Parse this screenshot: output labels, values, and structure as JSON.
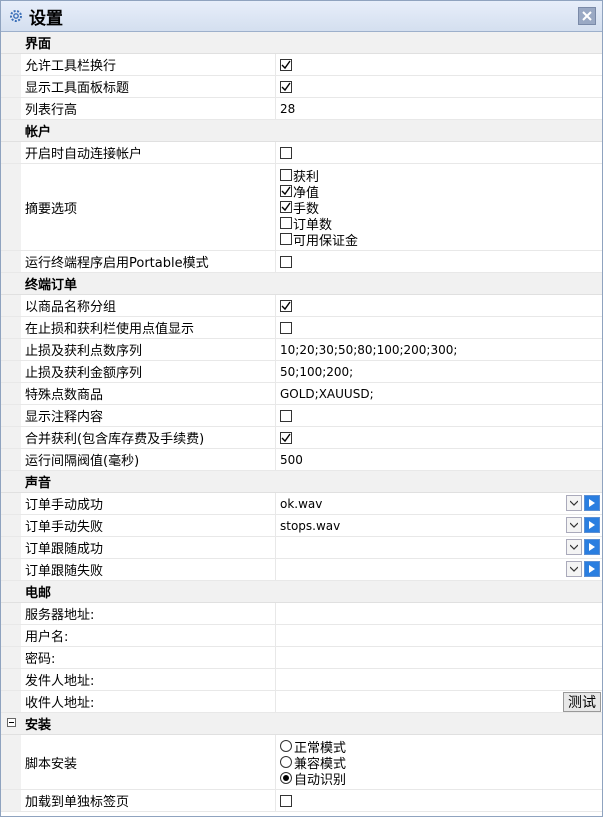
{
  "window": {
    "title": "设置"
  },
  "sections": {
    "ui": {
      "title": "界面",
      "allow_toolbar_wrap": {
        "label": "允许工具栏换行",
        "checked": true
      },
      "show_panel_title": {
        "label": "显示工具面板标题",
        "checked": true
      },
      "row_height": {
        "label": "列表行高",
        "value": "28"
      }
    },
    "account": {
      "title": "帐户",
      "auto_connect": {
        "label": "开启时自动连接帐户",
        "checked": false
      },
      "summary": {
        "label": "摘要选项",
        "options": [
          {
            "label": "获利",
            "checked": false
          },
          {
            "label": "净值",
            "checked": true
          },
          {
            "label": "手数",
            "checked": true
          },
          {
            "label": "订单数",
            "checked": false
          },
          {
            "label": "可用保证金",
            "checked": false
          }
        ]
      },
      "portable": {
        "label": "运行终端程序启用Portable模式",
        "checked": false
      }
    },
    "terminal_orders": {
      "title": "终端订单",
      "group_by_symbol": {
        "label": "以商品名称分组",
        "checked": true
      },
      "sl_tp_points": {
        "label": "在止损和获利栏使用点值显示",
        "checked": false
      },
      "sl_tp_points_list": {
        "label": "止损及获利点数序列",
        "value": "10;20;30;50;80;100;200;300;"
      },
      "sl_tp_amount_list": {
        "label": "止损及获利金额序列",
        "value": "50;100;200;"
      },
      "special_symbols": {
        "label": "特殊点数商品",
        "value": "GOLD;XAUUSD;"
      },
      "show_comment": {
        "label": "显示注释内容",
        "checked": false
      },
      "merge_profit": {
        "label": "合并获利(包含库存费及手续费)",
        "checked": true
      },
      "interval": {
        "label": "运行间隔阀值(毫秒)",
        "value": "500"
      }
    },
    "sound": {
      "title": "声音",
      "manual_success": {
        "label": "订单手动成功",
        "value": "ok.wav"
      },
      "manual_fail": {
        "label": "订单手动失败",
        "value": "stops.wav"
      },
      "follow_success": {
        "label": "订单跟随成功",
        "value": ""
      },
      "follow_fail": {
        "label": "订单跟随失败",
        "value": ""
      }
    },
    "email": {
      "title": "电邮",
      "server": {
        "label": "服务器地址:",
        "value": ""
      },
      "username": {
        "label": "用户名:",
        "value": ""
      },
      "password": {
        "label": "密码:",
        "value": ""
      },
      "sender": {
        "label": "发件人地址:",
        "value": ""
      },
      "receiver": {
        "label": "收件人地址:",
        "value": ""
      },
      "test_button": "测试"
    },
    "install": {
      "title": "安装",
      "collapse_icon": "minus-box",
      "script_install": {
        "label": "脚本安装",
        "options": [
          {
            "label": "正常模式",
            "selected": false
          },
          {
            "label": "兼容模式",
            "selected": false
          },
          {
            "label": "自动识别",
            "selected": true
          }
        ]
      },
      "separate_tab": {
        "label": "加载到单独标签页",
        "checked": false
      }
    }
  },
  "colors": {
    "category_bg": "#f1f1f1",
    "play_button": "#2a7ee0",
    "title_bar": "#dce6f4"
  }
}
